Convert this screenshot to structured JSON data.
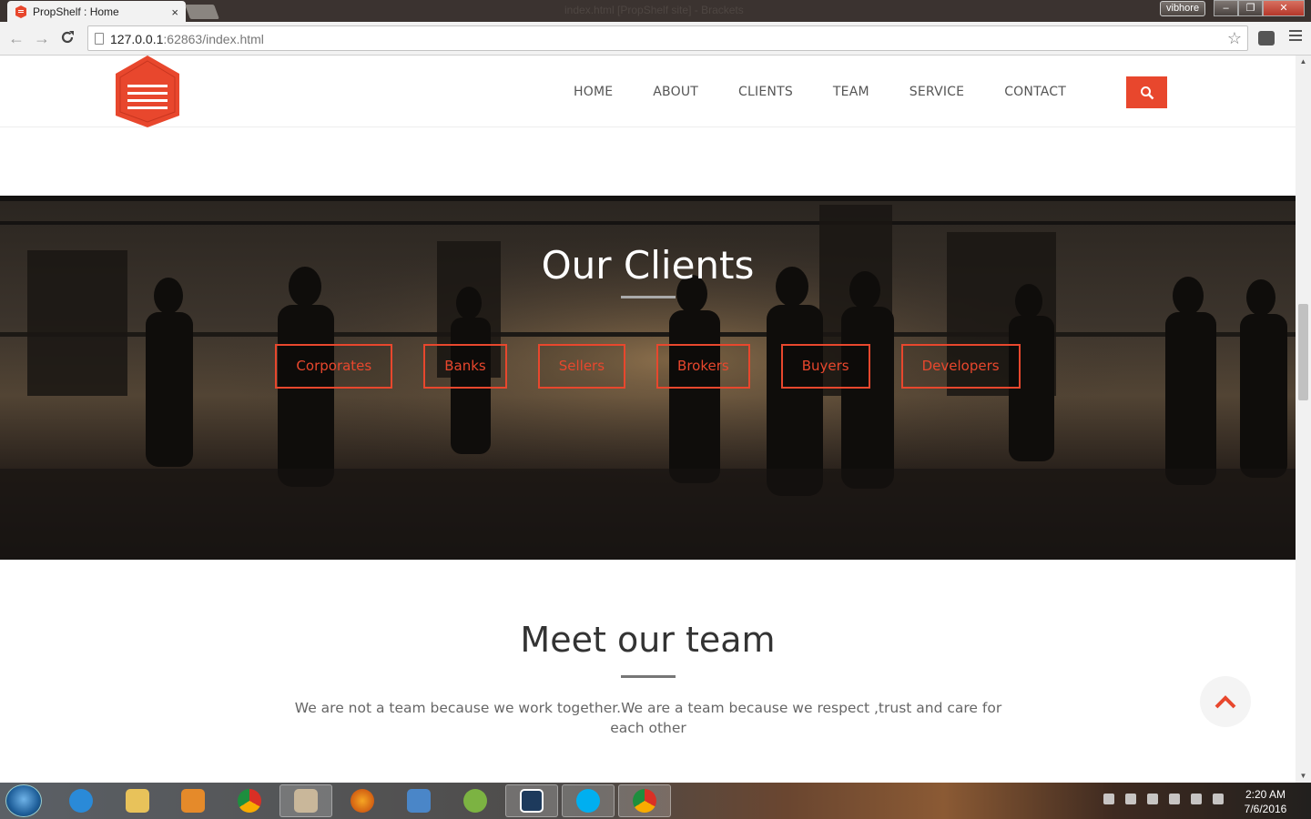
{
  "browser": {
    "tab_title": "PropShelf : Home",
    "tab_close": "×",
    "window_title": "index.html [PropShelf site] - Brackets",
    "profile_name": "vibhore",
    "url_host": "127.0.0.1",
    "url_rest": ":62863/index.html",
    "back_glyph": "←",
    "forward_glyph": "→",
    "reload_glyph": "C",
    "star_glyph": "☆",
    "min_glyph": "–",
    "max_glyph": "❐",
    "close_glyph": "✕"
  },
  "header": {
    "nav": [
      "HOME",
      "ABOUT",
      "CLIENTS",
      "TEAM",
      "SERVICE",
      "CONTACT"
    ],
    "accent": "#e8472d"
  },
  "clients_section": {
    "title": "Our Clients",
    "buttons": [
      "Corporates",
      "Banks",
      "Sellers",
      "Brokers",
      "Buyers",
      "Developers"
    ]
  },
  "team_section": {
    "title": "Meet our team",
    "description": "We are not a team because we work together.We are a team because we respect ,trust and care for each other"
  },
  "taskbar": {
    "time": "2:20 AM",
    "date": "7/6/2016",
    "apps": [
      "internet-explorer",
      "file-explorer",
      "media-player",
      "chrome",
      "paint",
      "firefox",
      "control-panel",
      "android-studio",
      "brackets",
      "skype",
      "chrome-active"
    ]
  }
}
